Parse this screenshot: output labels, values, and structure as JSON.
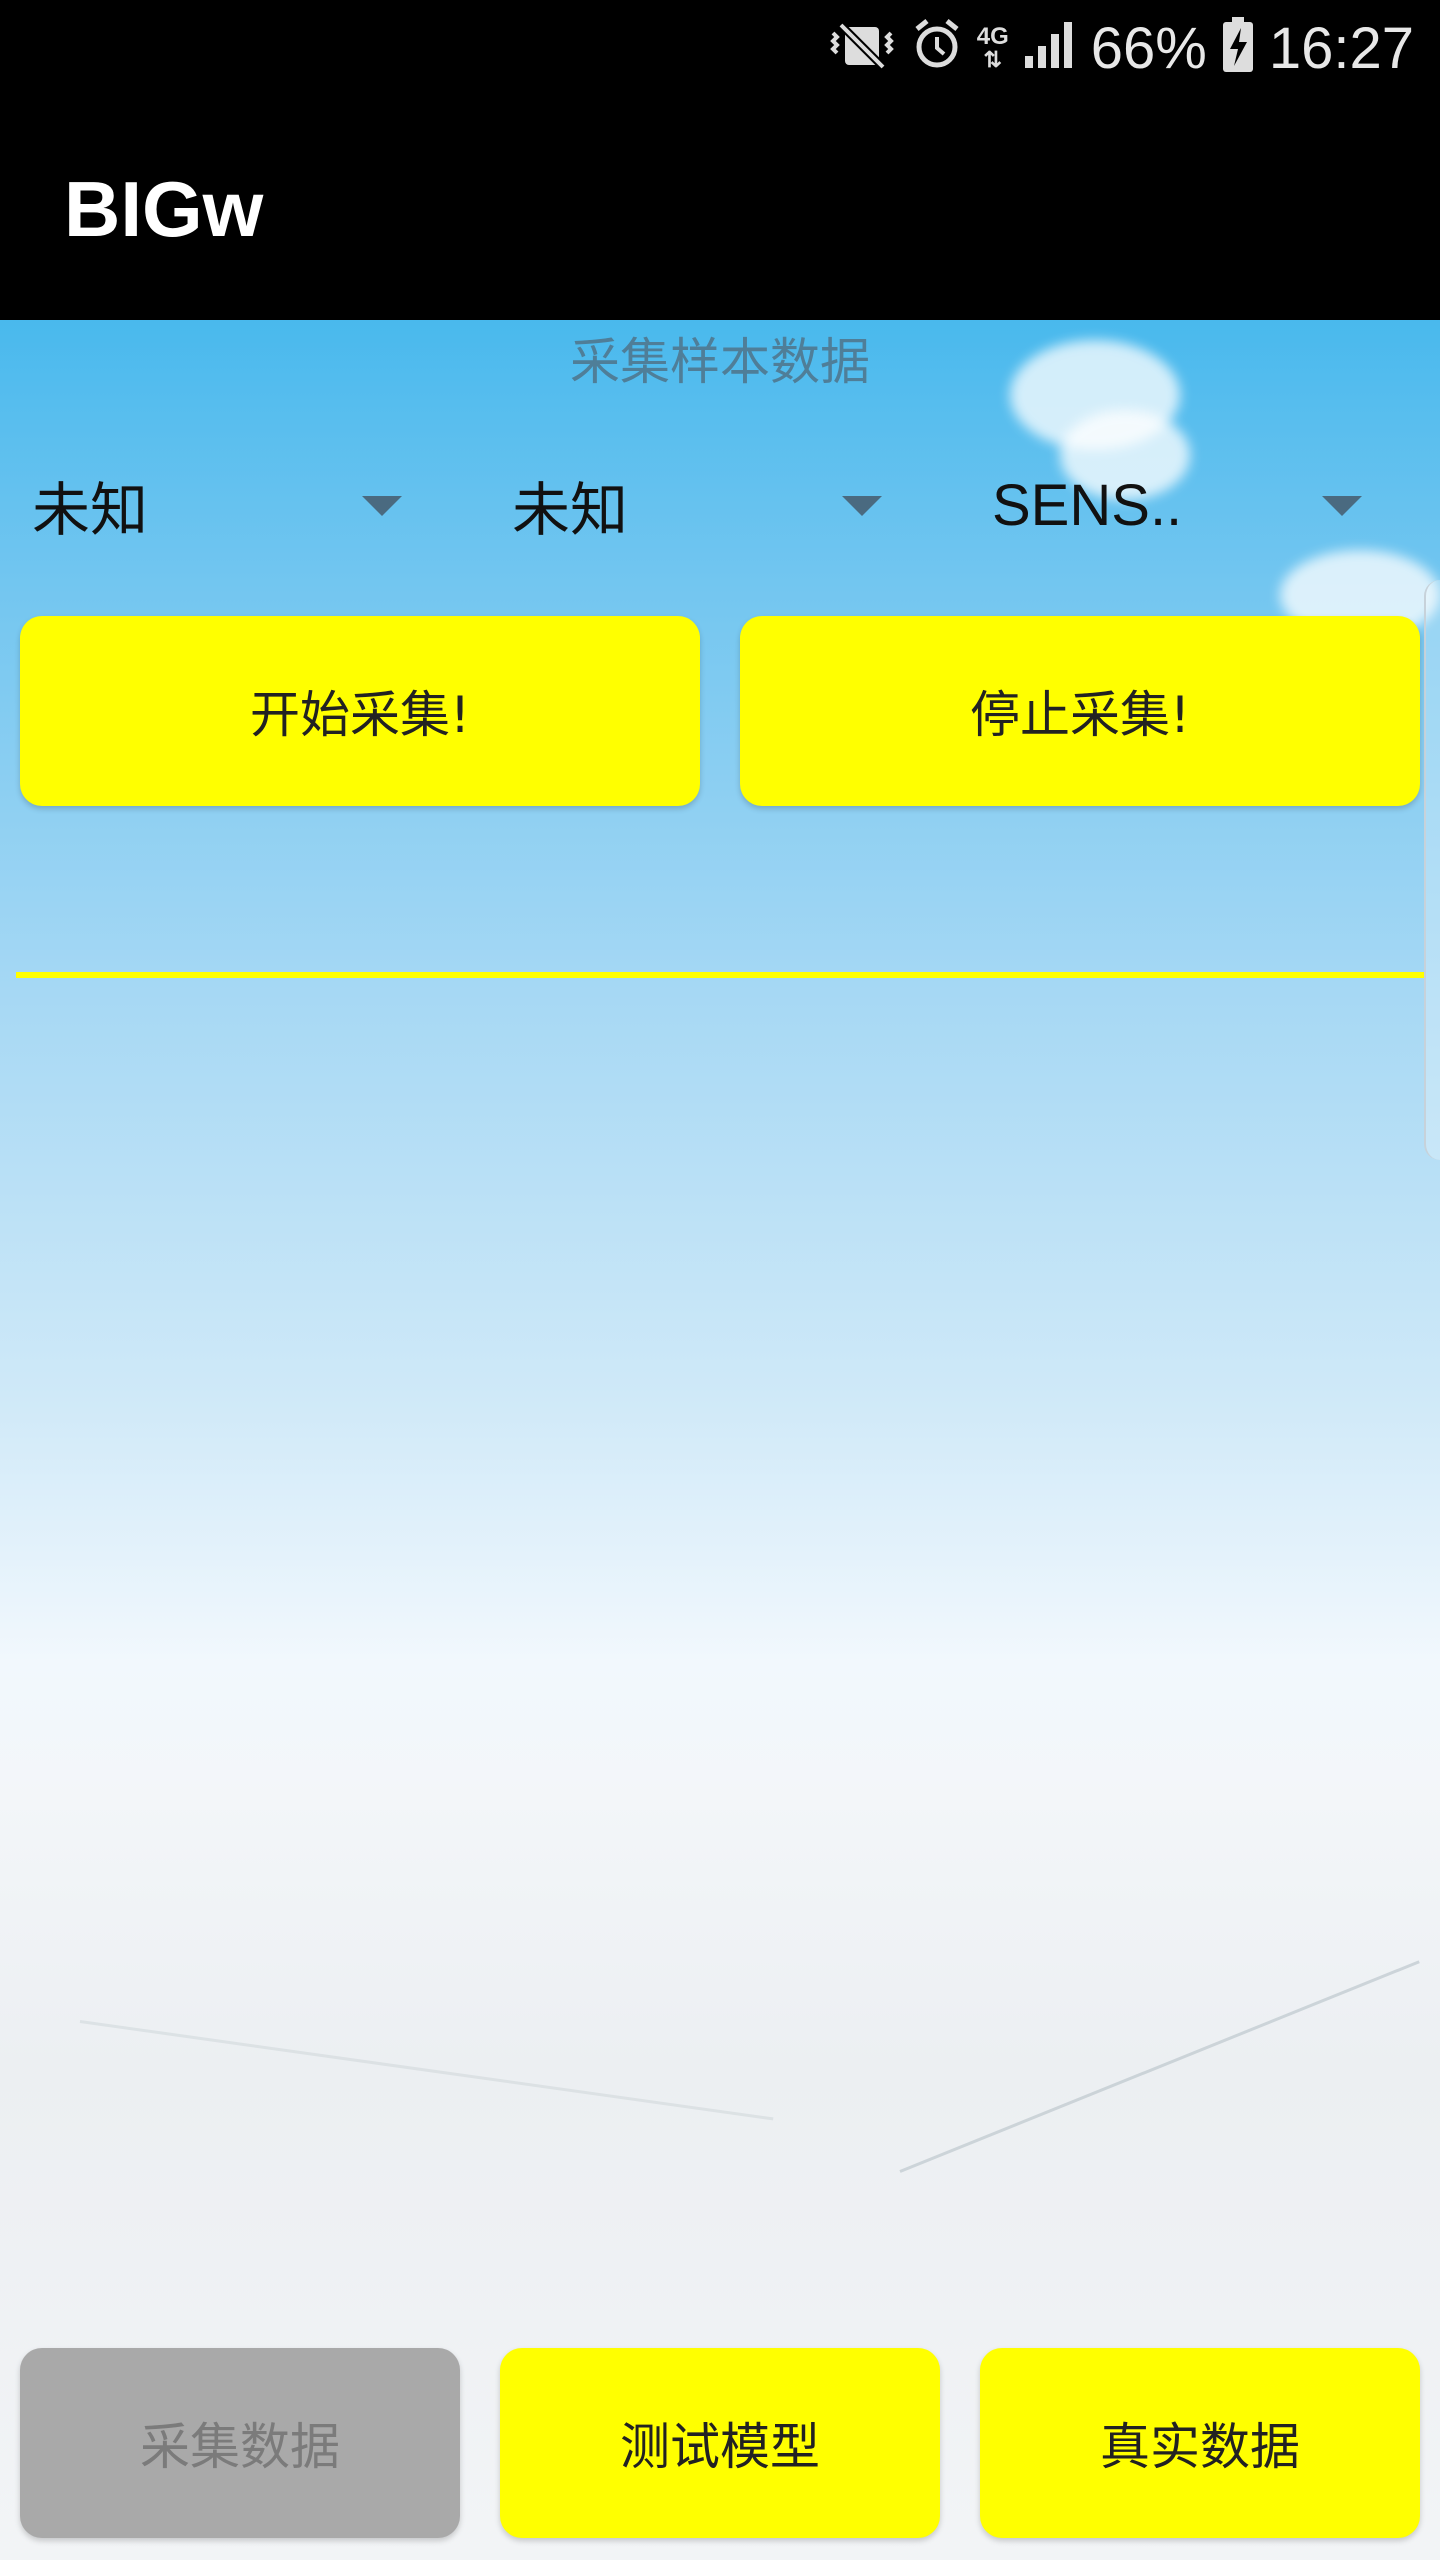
{
  "status_bar": {
    "network": "4G",
    "battery": "66%",
    "time": "16:27",
    "icons": [
      "vibrate-icon",
      "alarm-icon",
      "signal-icon",
      "battery-charging-icon"
    ]
  },
  "app_bar": {
    "title": "BIGw"
  },
  "main": {
    "section_title": "采集样本数据",
    "spinners": [
      {
        "selected": "未知"
      },
      {
        "selected": "未知"
      },
      {
        "selected": "SENS.."
      }
    ],
    "start_button": "开始采集!",
    "stop_button": "停止采集!"
  },
  "bottom_buttons": {
    "collect": "采集数据",
    "test_model": "测试模型",
    "real_data": "真实数据"
  },
  "colors": {
    "accent": "#ffff00",
    "disabled": "#a9a9a9",
    "bar": "#000000"
  }
}
